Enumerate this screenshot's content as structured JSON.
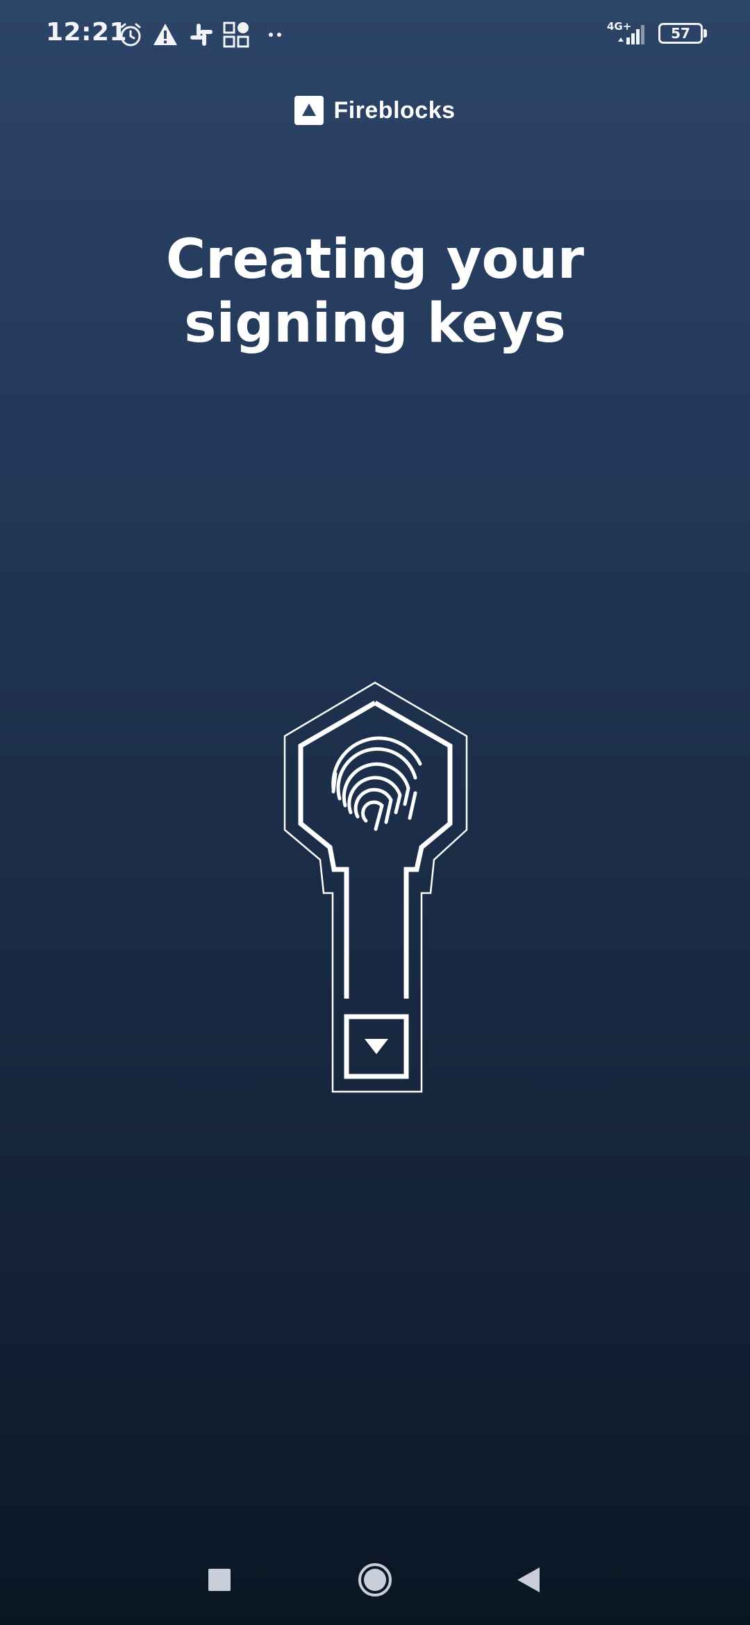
{
  "status_bar": {
    "time": "12:21",
    "network_type": "4G+",
    "battery_level": "57",
    "icons": [
      "alarm-icon",
      "warning-icon",
      "slack-icon",
      "apps-icon",
      "more-dots-icon",
      "signal-icon",
      "battery-icon"
    ]
  },
  "brand": {
    "name": "Fireblocks",
    "logo_icon": "fireblocks-logo-icon"
  },
  "main": {
    "title_line1": "Creating your",
    "title_line2": "signing keys",
    "illustration_icon": "key-fingerprint-icon"
  },
  "nav_bar": {
    "buttons": [
      "recents-icon",
      "home-icon",
      "back-icon"
    ]
  },
  "colors": {
    "background_top": "#2c4467",
    "background_bottom": "#091522",
    "foreground": "#ffffff"
  }
}
